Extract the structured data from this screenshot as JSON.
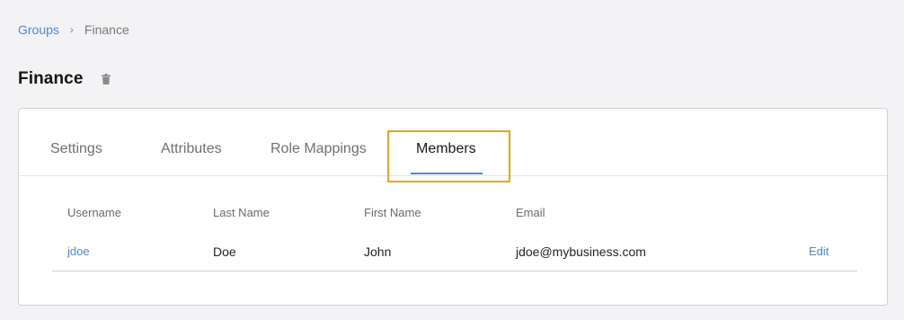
{
  "breadcrumb": {
    "parent": "Groups",
    "separator": "›",
    "current": "Finance"
  },
  "page": {
    "title": "Finance",
    "delete_icon": "trash-icon"
  },
  "tabs": [
    {
      "label": "Settings",
      "active": false
    },
    {
      "label": "Attributes",
      "active": false
    },
    {
      "label": "Role Mappings",
      "active": false
    },
    {
      "label": "Members",
      "active": true
    }
  ],
  "members_table": {
    "headers": [
      "Username",
      "Last Name",
      "First Name",
      "Email"
    ],
    "rows": [
      {
        "username": "jdoe",
        "last_name": "Doe",
        "first_name": "John",
        "email": "jdoe@mybusiness.com",
        "action": "Edit"
      }
    ]
  },
  "colors": {
    "accent": "#4a8ad6",
    "highlight": "#e6a817",
    "background": "#f3f3f5"
  }
}
